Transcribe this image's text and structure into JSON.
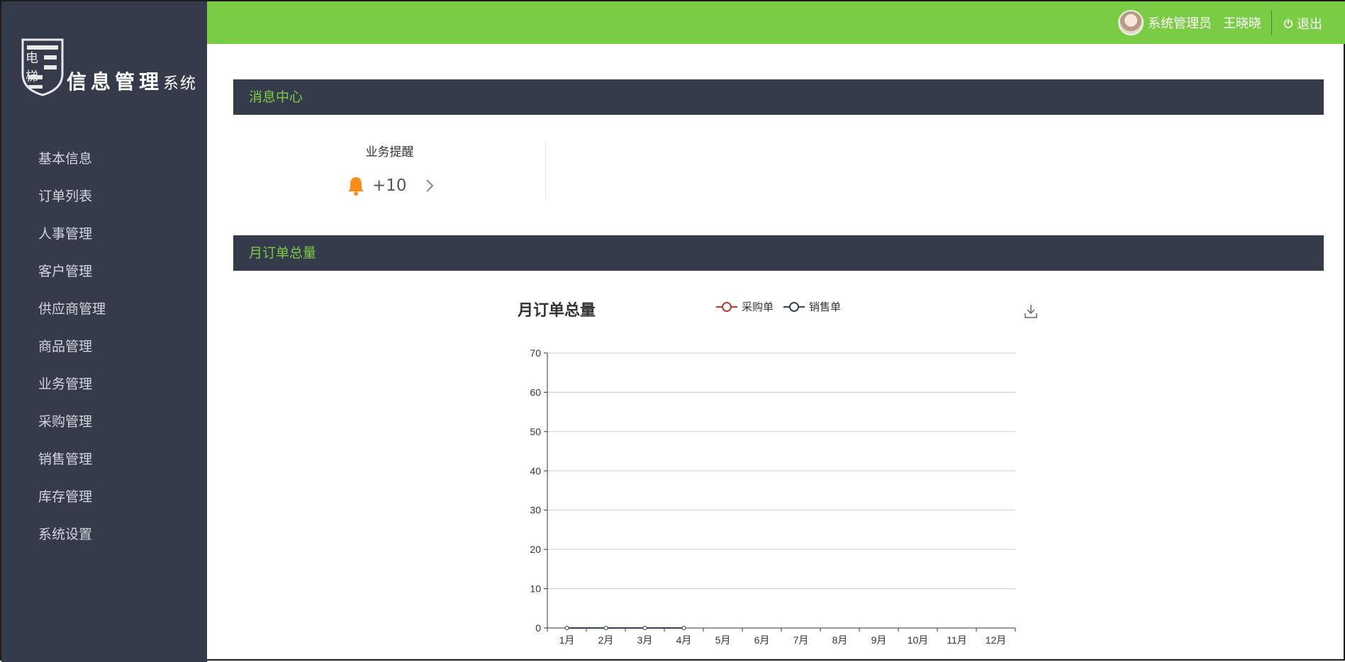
{
  "sidebar": {
    "logo_text": "信息管理",
    "logo_text_small": "系统",
    "logo_badge_text": "电梯",
    "items": [
      {
        "label": "基本信息"
      },
      {
        "label": "订单列表"
      },
      {
        "label": "人事管理"
      },
      {
        "label": "客户管理"
      },
      {
        "label": "供应商管理"
      },
      {
        "label": "商品管理"
      },
      {
        "label": "业务管理"
      },
      {
        "label": "采购管理"
      },
      {
        "label": "销售管理"
      },
      {
        "label": "库存管理"
      },
      {
        "label": "系统设置"
      }
    ]
  },
  "header": {
    "role": "系统管理员",
    "username": "王晓晓",
    "logout_label": "退出",
    "bg_color": "#7acc44"
  },
  "message_center": {
    "title": "消息中心",
    "reminder_label": "业务提醒",
    "reminder_count": "+10"
  },
  "orders_panel": {
    "title": "月订单总量"
  },
  "chart_data": {
    "type": "line",
    "title": "月订单总量",
    "categories": [
      "1月",
      "2月",
      "3月",
      "4月",
      "5月",
      "6月",
      "7月",
      "8月",
      "9月",
      "10月",
      "11月",
      "12月"
    ],
    "series": [
      {
        "name": "采购单",
        "color": "#c23531",
        "values": [
          0,
          0,
          0,
          0,
          null,
          null,
          null,
          null,
          null,
          null,
          null,
          null
        ]
      },
      {
        "name": "销售单",
        "color": "#2f4554",
        "values": [
          0,
          0,
          0,
          0,
          null,
          null,
          null,
          null,
          null,
          null,
          null,
          null
        ]
      }
    ],
    "ylim": [
      0,
      70
    ],
    "yticks": [
      0,
      10,
      20,
      30,
      40,
      50,
      60,
      70
    ],
    "grid": true,
    "legend": "top-center"
  },
  "colors": {
    "sidebar_bg": "#363b4c",
    "accent_green": "#7acc44",
    "bell_orange": "#ff8c1a"
  }
}
